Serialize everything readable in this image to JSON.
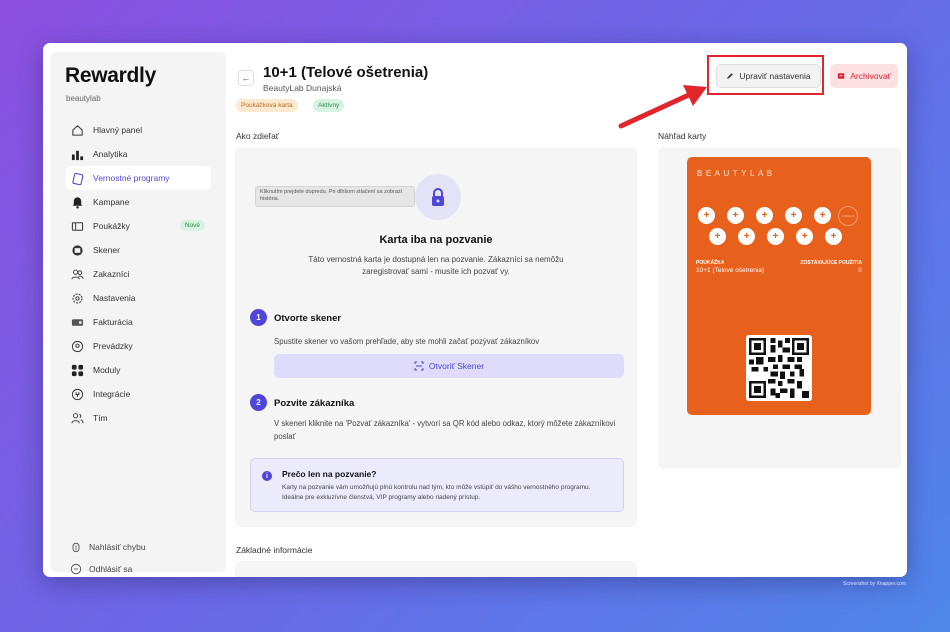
{
  "app": {
    "logo": "Rewardly",
    "tenant": "beautylab"
  },
  "sidebar": {
    "items": [
      {
        "label": "Hlavný panel",
        "icon": "home-icon",
        "active": false
      },
      {
        "label": "Analytika",
        "icon": "bar-chart-icon",
        "active": false
      },
      {
        "label": "Vernostné programy",
        "icon": "cards-icon",
        "active": true
      },
      {
        "label": "Kampane",
        "icon": "bell-icon",
        "active": false
      },
      {
        "label": "Poukážky",
        "icon": "ticket-icon",
        "active": false,
        "badge": "Nové"
      },
      {
        "label": "Skener",
        "icon": "scanner-icon",
        "active": false
      },
      {
        "label": "Zakazníci",
        "icon": "users-icon",
        "active": false
      },
      {
        "label": "Nastavenia",
        "icon": "gear-icon",
        "active": false
      },
      {
        "label": "Fakturácia",
        "icon": "credit-card-icon",
        "active": false
      },
      {
        "label": "Prevádzky",
        "icon": "location-icon",
        "active": false
      },
      {
        "label": "Moduly",
        "icon": "grid-icon",
        "active": false
      },
      {
        "label": "Integrácie",
        "icon": "plug-icon",
        "active": false
      },
      {
        "label": "Tím",
        "icon": "team-icon",
        "active": false
      }
    ],
    "bottom": [
      {
        "label": "Nahlásiť chybu",
        "icon": "bug-icon"
      },
      {
        "label": "Odhlásiť sa",
        "icon": "logout-icon"
      }
    ]
  },
  "header": {
    "back": "←",
    "title": "10+1 (Telové ošetrenia)",
    "store": "BeautyLab Dunajská",
    "tags": [
      "Poukážková karta",
      "Aktívny"
    ],
    "edit_label": "Upraviť nastavenia",
    "archive_label": "Archivovať"
  },
  "share": {
    "section_label": "Ako zdieľať",
    "tooltip": "Kliknutím prejdete dopredu. Pri dlhšom stlačení sa zobrazí história.",
    "invite_title": "Karta iba na pozvanie",
    "invite_desc": "Táto vernostná karta je dostupná len na pozvanie. Zákazníci sa nemôžu zaregistrovať sami - musíte ich pozvať vy.",
    "steps": [
      {
        "num": "1",
        "title": "Otvorte skener",
        "desc": "Spustite skener vo vašom prehľade, aby ste mohli začať pozývať zákazníkov",
        "button": "Otvoriť Skener"
      },
      {
        "num": "2",
        "title": "Pozvite zákazníka",
        "desc": "V skeneri kliknite na 'Pozvať zákazníka' - vytvorí sa QR kód alebo odkaz, ktorý môžete zákazníkovi poslať"
      }
    ],
    "info_title": "Prečo len na pozvanie?",
    "info_text": "Karty na pozvanie vám umožňujú plnú kontrolu nad tým, kto môže vstúpiť do vášho vernostného programu. Ideálne pre exkluzívne členstvá, VIP programy alebo riadený prístup."
  },
  "basic_info": {
    "label": "Základné informácie"
  },
  "preview": {
    "label": "Náhľad karty",
    "brand": "BEAUTYLAB",
    "stamps_total": 10,
    "stamps_filled": 10,
    "reward_stamp_text": "ODMENA",
    "voucher_label": "POUKÁŽKA",
    "voucher_value": "10+1 (Telové ošetrenia)",
    "remaining_label": "ZOSTÁVAJÚCE POUŽITIA",
    "remaining_value": "0",
    "card_color": "#e8611c"
  },
  "footer": {
    "credit": "Screenshot by Xnapper.com"
  }
}
